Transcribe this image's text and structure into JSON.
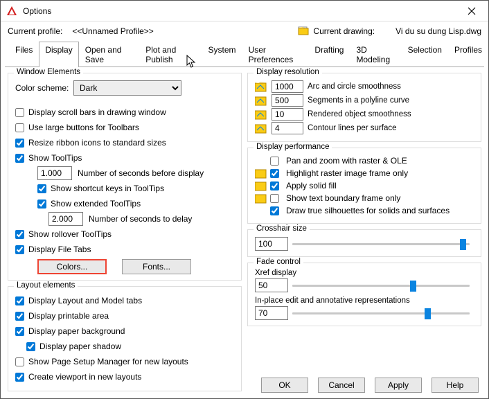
{
  "window": {
    "title": "Options"
  },
  "header": {
    "profile_label": "Current profile:",
    "profile_value": "<<Unnamed Profile>>",
    "drawing_label": "Current drawing:",
    "drawing_file": "Vi du su dung Lisp.dwg"
  },
  "tabs": [
    "Files",
    "Display",
    "Open and Save",
    "Plot and Publish",
    "System",
    "User Preferences",
    "Drafting",
    "3D Modeling",
    "Selection",
    "Profiles"
  ],
  "active_tab": "Display",
  "window_elements": {
    "group_title": "Window Elements",
    "color_scheme_label": "Color scheme:",
    "color_scheme_value": "Dark",
    "scroll_bars": {
      "label": "Display scroll bars in drawing window",
      "checked": false
    },
    "large_buttons": {
      "label": "Use large buttons for Toolbars",
      "checked": false
    },
    "resize_ribbon": {
      "label": "Resize ribbon icons to standard sizes",
      "checked": true
    },
    "show_tooltips": {
      "label": "Show ToolTips",
      "checked": true
    },
    "seconds_before_value": "1.000",
    "seconds_before_label": "Number of seconds before display",
    "show_shortcut": {
      "label": "Show shortcut keys in ToolTips",
      "checked": true
    },
    "show_extended": {
      "label": "Show extended ToolTips",
      "checked": true
    },
    "seconds_delay_value": "2.000",
    "seconds_delay_label": "Number of seconds to delay",
    "rollover": {
      "label": "Show rollover ToolTips",
      "checked": true
    },
    "file_tabs": {
      "label": "Display File Tabs",
      "checked": true
    },
    "colors_btn": "Colors...",
    "fonts_btn": "Fonts..."
  },
  "layout_elements": {
    "group_title": "Layout elements",
    "layout_model": {
      "label": "Display Layout and Model tabs",
      "checked": true
    },
    "printable": {
      "label": "Display printable area",
      "checked": true
    },
    "paper_bg": {
      "label": "Display paper background",
      "checked": true
    },
    "paper_shadow": {
      "label": "Display paper shadow",
      "checked": true
    },
    "page_setup": {
      "label": "Show Page Setup Manager for new layouts",
      "checked": false
    },
    "create_viewport": {
      "label": "Create viewport in new layouts",
      "checked": true
    }
  },
  "display_resolution": {
    "group_title": "Display resolution",
    "arc": {
      "value": "1000",
      "label": "Arc and circle smoothness"
    },
    "seg": {
      "value": "500",
      "label": "Segments in a polyline curve"
    },
    "ren": {
      "value": "10",
      "label": "Rendered object smoothness"
    },
    "con": {
      "value": "4",
      "label": "Contour lines per surface"
    }
  },
  "display_performance": {
    "group_title": "Display performance",
    "pan": {
      "label": "Pan and zoom with raster & OLE",
      "checked": false
    },
    "highlight": {
      "label": "Highlight raster image frame only",
      "checked": true
    },
    "solid": {
      "label": "Apply solid fill",
      "checked": true
    },
    "boundary": {
      "label": "Show text boundary frame only",
      "checked": false
    },
    "silhouettes": {
      "label": "Draw true silhouettes for solids and surfaces",
      "checked": true
    }
  },
  "crosshair": {
    "group_title": "Crosshair size",
    "value": "100",
    "pct": 96
  },
  "fade": {
    "group_title": "Fade control",
    "xref_label": "Xref display",
    "xref_value": "50",
    "xref_pct": 68,
    "inplace_label": "In-place edit and annotative representations",
    "inplace_value": "70",
    "inplace_pct": 76
  },
  "buttons": {
    "ok": "OK",
    "cancel": "Cancel",
    "apply": "Apply",
    "help": "Help"
  }
}
